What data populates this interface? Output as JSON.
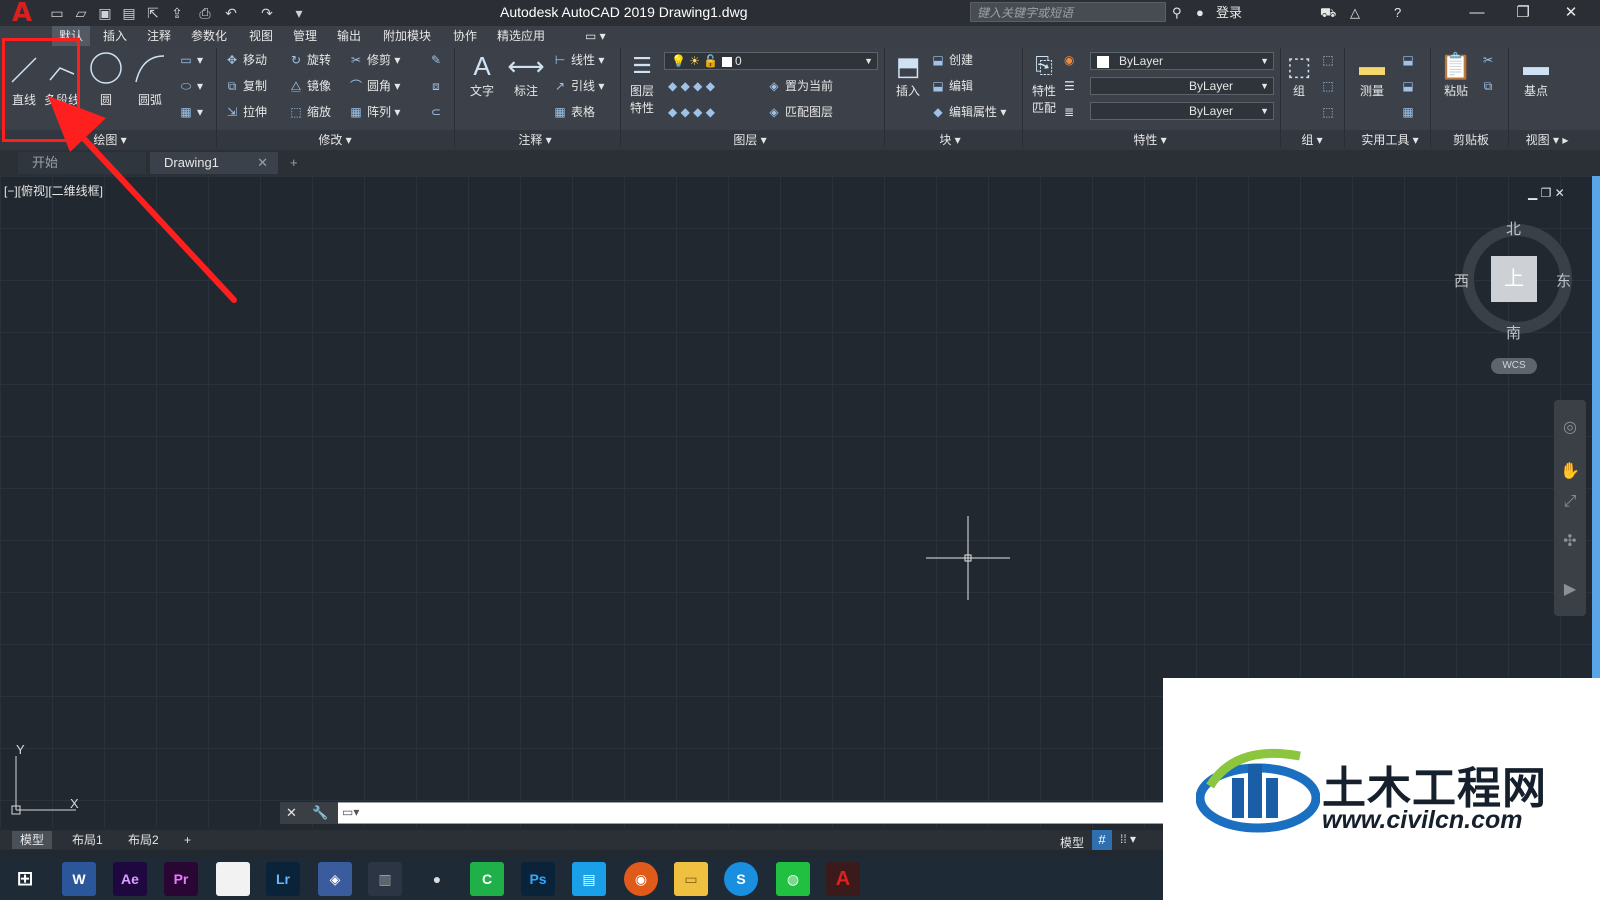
{
  "title_bar": {
    "logo": "A",
    "title": "Autodesk AutoCAD 2019    Drawing1.dwg",
    "search_placeholder": "键入关键字或短语",
    "login": "登录"
  },
  "menu_tabs": [
    "默认",
    "插入",
    "注释",
    "参数化",
    "视图",
    "管理",
    "输出",
    "附加模块",
    "协作",
    "精选应用"
  ],
  "ribbon": {
    "draw": {
      "line": "直线",
      "polyline": "多段线",
      "circle": "圆",
      "arc": "圆弧",
      "panel": "绘图"
    },
    "modify": {
      "move": "移动",
      "rotate": "旋转",
      "trim": "修剪",
      "copy": "复制",
      "mirror": "镜像",
      "fillet": "圆角",
      "stretch": "拉伸",
      "scale": "缩放",
      "array": "阵列",
      "panel": "修改"
    },
    "annotation": {
      "text": "文字",
      "dimension": "标注",
      "linear": "线性",
      "leader": "引线",
      "table": "表格",
      "panel": "注释"
    },
    "layers": {
      "layer_props_1": "图层",
      "layer_props_2": "特性",
      "current_layer": "0",
      "set_current": "置为当前",
      "match_layer": "匹配图层",
      "panel": "图层"
    },
    "block": {
      "insert": "插入",
      "create": "创建",
      "edit": "编辑",
      "edit_attr": "编辑属性",
      "panel": "块"
    },
    "properties": {
      "match_1": "特性",
      "match_2": "匹配",
      "color": "ByLayer",
      "linetype": "ByLayer",
      "lineweight": "ByLayer",
      "panel": "特性"
    },
    "groups": {
      "group": "组",
      "panel": "组"
    },
    "utilities": {
      "measure": "测量",
      "panel": "实用工具"
    },
    "clipboard": {
      "paste": "粘贴",
      "panel": "剪贴板"
    },
    "view": {
      "base": "基点",
      "panel": "视图"
    }
  },
  "doc_tabs": {
    "start": "开始",
    "drawing": "Drawing1"
  },
  "viewport": {
    "label": "[−][俯视][二维线框]",
    "compass": {
      "north": "北",
      "south": "南",
      "east": "东",
      "west": "西",
      "face": "上"
    },
    "wcs": "WCS",
    "axis_x": "X",
    "axis_y": "Y"
  },
  "layout_tabs": [
    "模型",
    "布局1",
    "布局2"
  ],
  "status": {
    "model": "模型"
  },
  "taskbar": [
    "W",
    "Ae",
    "Pr",
    "",
    "Lr",
    "",
    "",
    "",
    "C",
    "Ps",
    "",
    "",
    "",
    "",
    "",
    "A"
  ],
  "watermark": {
    "cn": "土木工程网",
    "url": "www.civilcn.com"
  },
  "colors": {
    "accent": "#d8201f",
    "canvas": "#212830",
    "highlight": "#ff1f1f"
  }
}
